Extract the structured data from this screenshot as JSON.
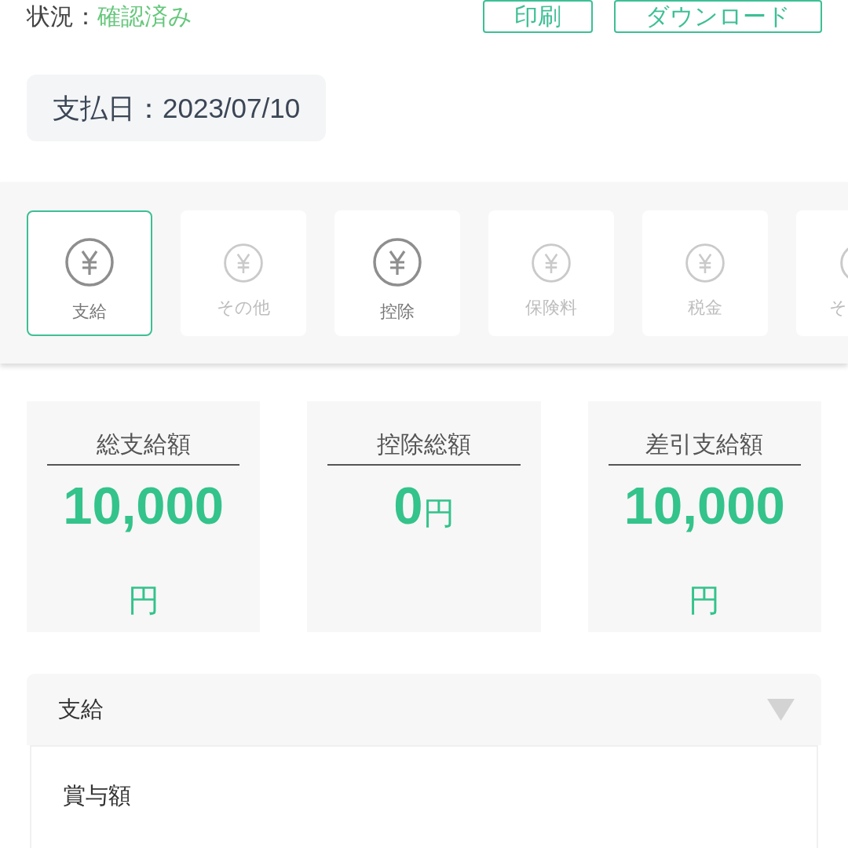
{
  "status": {
    "label": "状況：",
    "value": "確認済み"
  },
  "actions": [
    {
      "label": "印刷"
    },
    {
      "label": "ダウンロード"
    }
  ],
  "payment_date": "支払日：2023/07/10",
  "categories": [
    {
      "kind": "card",
      "label": "支給",
      "selected": true,
      "disabled": false
    },
    {
      "kind": "card",
      "label": "その他",
      "selected": false,
      "disabled": true
    },
    {
      "kind": "card",
      "label": "控除",
      "selected": false,
      "disabled": false
    },
    {
      "kind": "card",
      "label": "保険料",
      "selected": false,
      "disabled": true
    },
    {
      "kind": "card",
      "label": "税金",
      "selected": false,
      "disabled": true
    },
    {
      "kind": "partial",
      "label": "そ",
      "selected": false,
      "disabled": true
    }
  ],
  "summary": [
    {
      "title": "総支給額",
      "amount": "10,000",
      "unit": "円"
    },
    {
      "title": "控除総額",
      "amount": "0",
      "unit": "円"
    },
    {
      "title": "差引支給額",
      "amount": "10,000",
      "unit": "円"
    }
  ],
  "section": {
    "title": "支給",
    "expanded": true,
    "items": [
      {
        "label": "賞与額"
      }
    ]
  }
}
